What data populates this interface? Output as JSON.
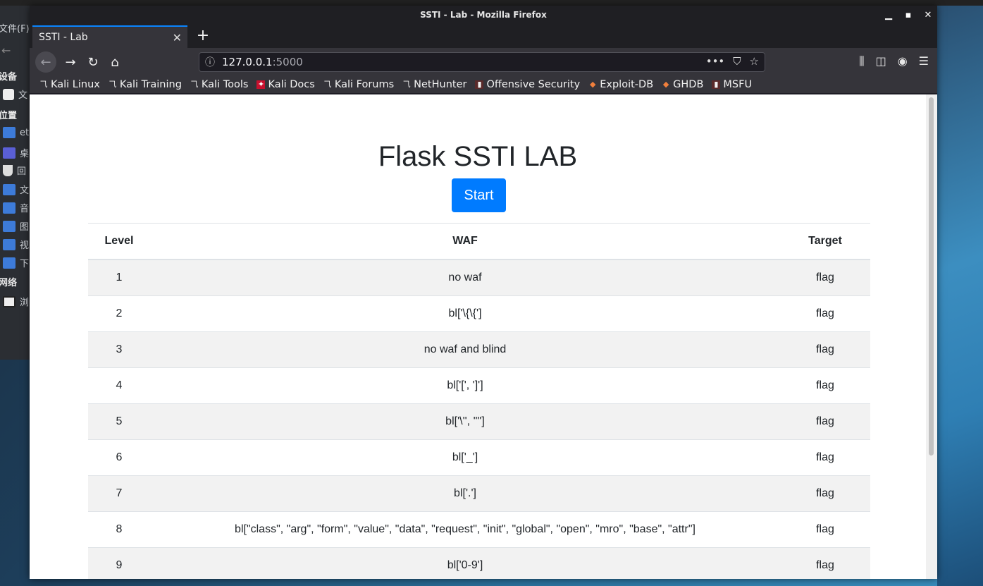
{
  "file_manager": {
    "menu_label": "文件(F)",
    "sections": {
      "devices": "设备",
      "places": "位置",
      "network": "网络"
    },
    "items": [
      "文",
      "et",
      "桌",
      "回",
      "文",
      "音",
      "图",
      "视",
      "下",
      "浏"
    ]
  },
  "window": {
    "title": "SSTI - Lab - Mozilla Firefox"
  },
  "tab": {
    "label": "SSTI - Lab",
    "close_icon": "close-icon",
    "new_tab": "+"
  },
  "url": {
    "host": "127.0.0.1",
    "port": ":5000",
    "more": "•••"
  },
  "bookmarks": [
    {
      "label": "Kali Linux",
      "icon": "kali-icon"
    },
    {
      "label": "Kali Training",
      "icon": "kali-icon"
    },
    {
      "label": "Kali Tools",
      "icon": "kali-icon"
    },
    {
      "label": "Kali Docs",
      "icon": "docs-icon"
    },
    {
      "label": "Kali Forums",
      "icon": "kali-icon"
    },
    {
      "label": "NetHunter",
      "icon": "nethunter-icon"
    },
    {
      "label": "Offensive Security",
      "icon": "offsec-icon"
    },
    {
      "label": "Exploit-DB",
      "icon": "exploitdb-icon"
    },
    {
      "label": "GHDB",
      "icon": "exploitdb-icon"
    },
    {
      "label": "MSFU",
      "icon": "offsec-icon"
    }
  ],
  "page": {
    "heading": "Flask SSTI LAB",
    "start_button": "Start",
    "table": {
      "headers": [
        "Level",
        "WAF",
        "Target"
      ],
      "rows": [
        {
          "level": "1",
          "waf": "no waf",
          "target": "flag"
        },
        {
          "level": "2",
          "waf": "bl['\\{\\{']",
          "target": "flag"
        },
        {
          "level": "3",
          "waf": "no waf and blind",
          "target": "flag"
        },
        {
          "level": "4",
          "waf": "bl['[', ']']",
          "target": "flag"
        },
        {
          "level": "5",
          "waf": "bl['\\'', '\"']",
          "target": "flag"
        },
        {
          "level": "6",
          "waf": "bl['_']",
          "target": "flag"
        },
        {
          "level": "7",
          "waf": "bl['.']",
          "target": "flag"
        },
        {
          "level": "8",
          "waf": "bl[\"class\", \"arg\", \"form\", \"value\", \"data\", \"request\", \"init\", \"global\", \"open\", \"mro\", \"base\", \"attr\"]",
          "target": "flag"
        },
        {
          "level": "9",
          "waf": "bl['0-9']",
          "target": "flag"
        }
      ]
    }
  },
  "colors": {
    "accent": "#007bff",
    "tab_highlight": "#0a84ff"
  }
}
